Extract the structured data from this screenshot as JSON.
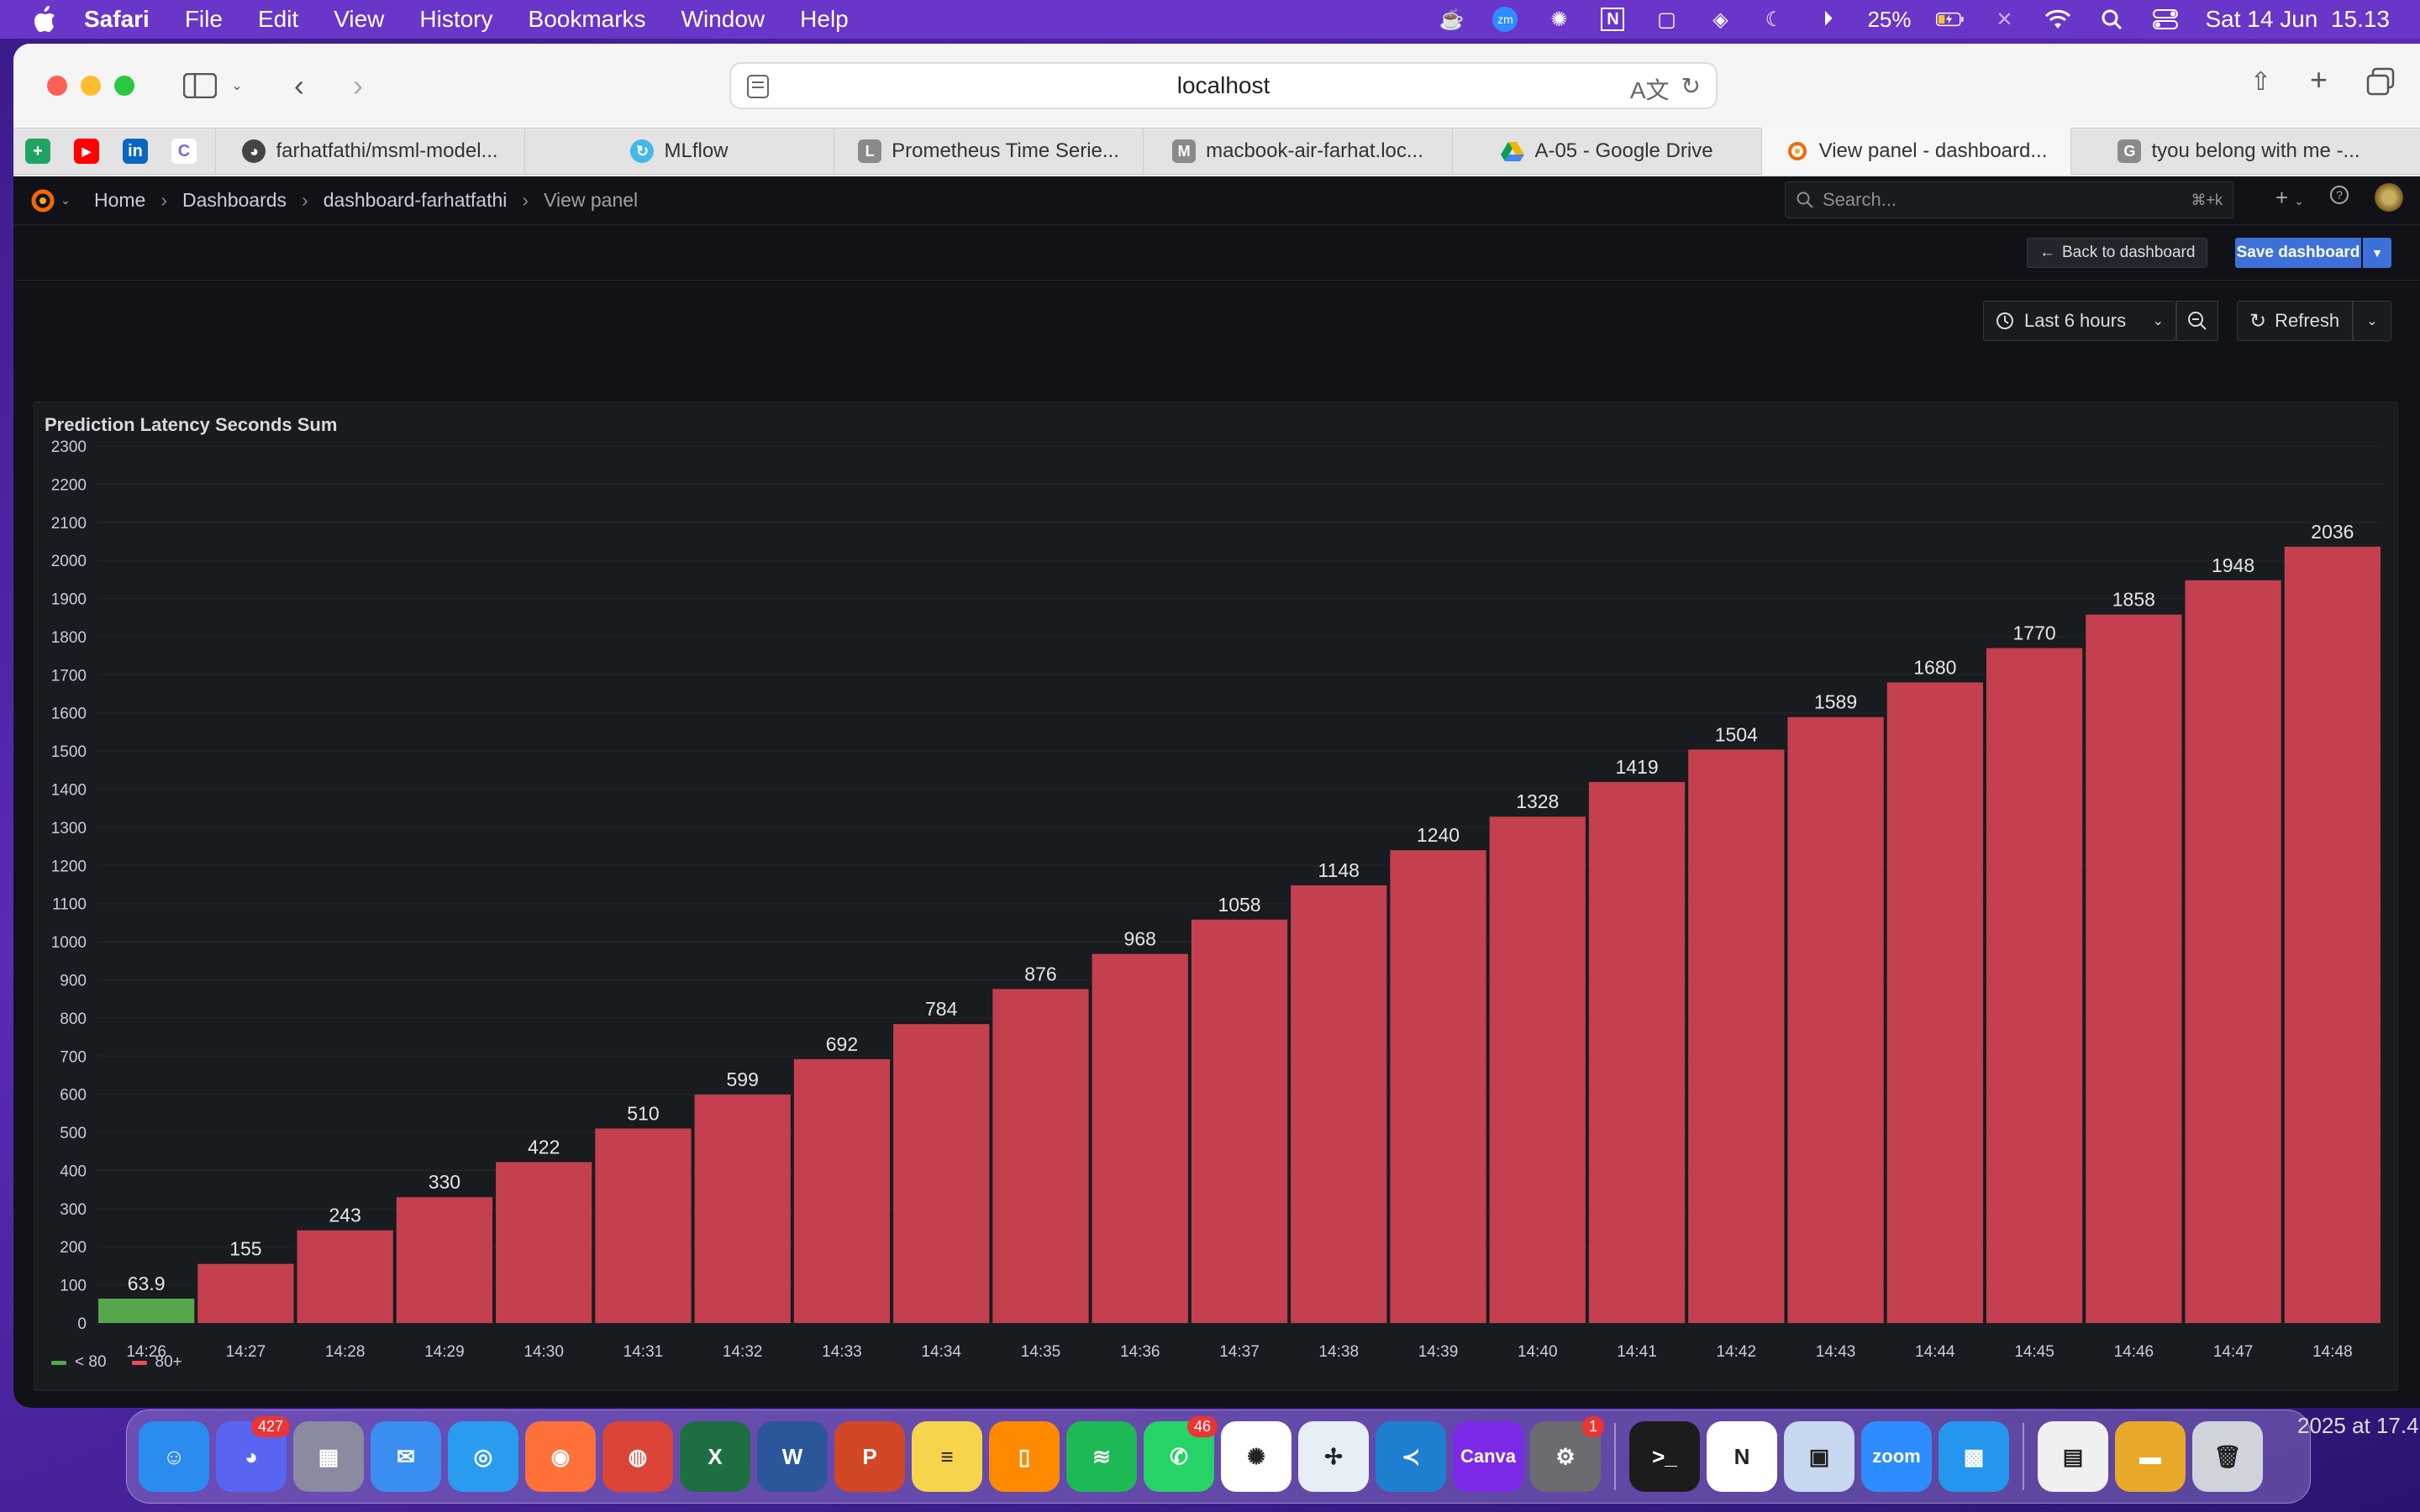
{
  "menubar": {
    "app": "Safari",
    "items": [
      "File",
      "Edit",
      "View",
      "History",
      "Bookmarks",
      "Window",
      "Help"
    ],
    "battery": "25%",
    "datetime": "Sat 14 Jun  15.13",
    "status_icons": [
      "stage-manager-icon",
      "zoom-icon",
      "chatgpt-icon",
      "notion-icon",
      "screen-record-icon",
      "layers-icon",
      "moon-icon",
      "play-icon",
      "battery-icon",
      "bluetooth-icon",
      "wifi-icon",
      "search-icon",
      "control-center-icon"
    ]
  },
  "browser": {
    "url": "localhost",
    "pinned_tabs": [
      {
        "label": "+",
        "color": "#1fa463"
      },
      {
        "label": "▶",
        "color": "#ff0000"
      },
      {
        "label": "in",
        "color": "#0a66c2"
      },
      {
        "label": "C",
        "color": "#ffffff"
      }
    ],
    "tabs": [
      {
        "title": "farhatfathi/msml-model...",
        "icon": "docker-icon",
        "color": "#555555"
      },
      {
        "title": "MLflow",
        "icon": "mlflow-icon",
        "color": "#43b9e8"
      },
      {
        "title": "Prometheus Time Serie...",
        "icon": "L",
        "color": "#8a8a8a"
      },
      {
        "title": "macbook-air-farhat.loc...",
        "icon": "M",
        "color": "#8a8a8a"
      },
      {
        "title": "A-05 - Google Drive",
        "icon": "drive-icon",
        "color": "#f4b400"
      },
      {
        "title": "View panel - dashboard...",
        "icon": "grafana-icon",
        "color": "#f46800"
      },
      {
        "title": "tyou belong with me -...",
        "icon": "G",
        "color": "#8a8a8a"
      }
    ]
  },
  "grafana": {
    "breadcrumb": [
      "Home",
      "Dashboards",
      "dashboard-farhatfathi",
      "View panel"
    ],
    "search_placeholder": "Search...",
    "search_shortcut": "⌘+k",
    "back_label": "Back to dashboard",
    "save_label": "Save dashboard",
    "time_range": "Last 6 hours",
    "refresh_label": "Refresh",
    "panel_title": "Prediction Latency Seconds Sum",
    "legend": [
      {
        "label": "< 80",
        "color": "#56a64b"
      },
      {
        "label": "80+",
        "color": "#f2495c"
      }
    ]
  },
  "chart_data": {
    "type": "bar",
    "title": "Prediction Latency Seconds Sum",
    "xlabel": "",
    "ylabel": "",
    "categories": [
      "14:26",
      "14:27",
      "14:28",
      "14:29",
      "14:30",
      "14:31",
      "14:32",
      "14:33",
      "14:34",
      "14:35",
      "14:36",
      "14:37",
      "14:38",
      "14:39",
      "14:40",
      "14:41",
      "14:42",
      "14:43",
      "14:44",
      "14:45",
      "14:46",
      "14:47",
      "14:48"
    ],
    "values": [
      63.9,
      155,
      243,
      330,
      422,
      510,
      599,
      692,
      784,
      876,
      968,
      1058,
      1148,
      1240,
      1328,
      1419,
      1504,
      1589,
      1680,
      1770,
      1858,
      1948,
      2036
    ],
    "labels": [
      "63.9",
      "155",
      "243",
      "330",
      "422",
      "510",
      "599",
      "692",
      "784",
      "876",
      "968",
      "1058",
      "1148",
      "1240",
      "1328",
      "1419",
      "1504",
      "1589",
      "1680",
      "1770",
      "1858",
      "1948",
      "2036"
    ],
    "ylim": [
      0,
      2300
    ],
    "yticks": [
      0,
      100,
      200,
      300,
      400,
      500,
      600,
      700,
      800,
      900,
      1000,
      1100,
      1200,
      1300,
      1400,
      1500,
      1600,
      1700,
      1800,
      1900,
      2000,
      2100,
      2200,
      2300
    ],
    "threshold": 80,
    "colors": {
      "below": "#56a64b",
      "above": "#c4404f"
    },
    "grid": true,
    "legend_position": "bottom-left"
  },
  "dock": {
    "apps": [
      {
        "name": "finder",
        "label": "☺",
        "color": "#2b8cf0"
      },
      {
        "name": "discord",
        "label": "◕",
        "color": "#5865f2",
        "badge": "427"
      },
      {
        "name": "launchpad",
        "label": "▦",
        "color": "#8a8aa0"
      },
      {
        "name": "mail",
        "label": "✉",
        "color": "#3a8ef0"
      },
      {
        "name": "safari",
        "label": "◎",
        "color": "#2a9cf0"
      },
      {
        "name": "firefox",
        "label": "◉",
        "color": "#ff7139"
      },
      {
        "name": "chrome",
        "label": "◍",
        "color": "#db4437"
      },
      {
        "name": "excel",
        "label": "X",
        "color": "#1d6f42"
      },
      {
        "name": "word",
        "label": "W",
        "color": "#2b579a"
      },
      {
        "name": "powerpoint",
        "label": "P",
        "color": "#d24726"
      },
      {
        "name": "notes",
        "label": "≡",
        "color": "#f6d44b"
      },
      {
        "name": "books",
        "label": "▯",
        "color": "#ff8a00"
      },
      {
        "name": "spotify",
        "label": "≋",
        "color": "#1db954"
      },
      {
        "name": "whatsapp",
        "label": "✆",
        "color": "#25d366",
        "badge": "46"
      },
      {
        "name": "chatgpt",
        "label": "✺",
        "color": "#ffffff"
      },
      {
        "name": "tableau",
        "label": "✢",
        "color": "#e8eef6"
      },
      {
        "name": "vscode",
        "label": "≺",
        "color": "#1e7fd1"
      },
      {
        "name": "canva",
        "label": "Canva",
        "color": "#7d2ae8"
      },
      {
        "name": "system-settings",
        "label": "⚙",
        "color": "#6b6b70",
        "badge": "1"
      },
      {
        "name": "terminal",
        "label": ">_",
        "color": "#1c1c1c"
      },
      {
        "name": "notion",
        "label": "N",
        "color": "#ffffff"
      },
      {
        "name": "preview",
        "label": "▣",
        "color": "#c8d8f0"
      },
      {
        "name": "zoom",
        "label": "zoom",
        "color": "#2d8cff"
      },
      {
        "name": "docker",
        "label": "▩",
        "color": "#2496ed"
      },
      {
        "name": "documents",
        "label": "▤",
        "color": "#f0f0f0"
      },
      {
        "name": "drive-folder",
        "label": "▬",
        "color": "#e9a92a"
      },
      {
        "name": "trash",
        "label": "🗑",
        "color": "#cfd4da"
      }
    ],
    "desktop_text": "2025 at 17.4"
  }
}
